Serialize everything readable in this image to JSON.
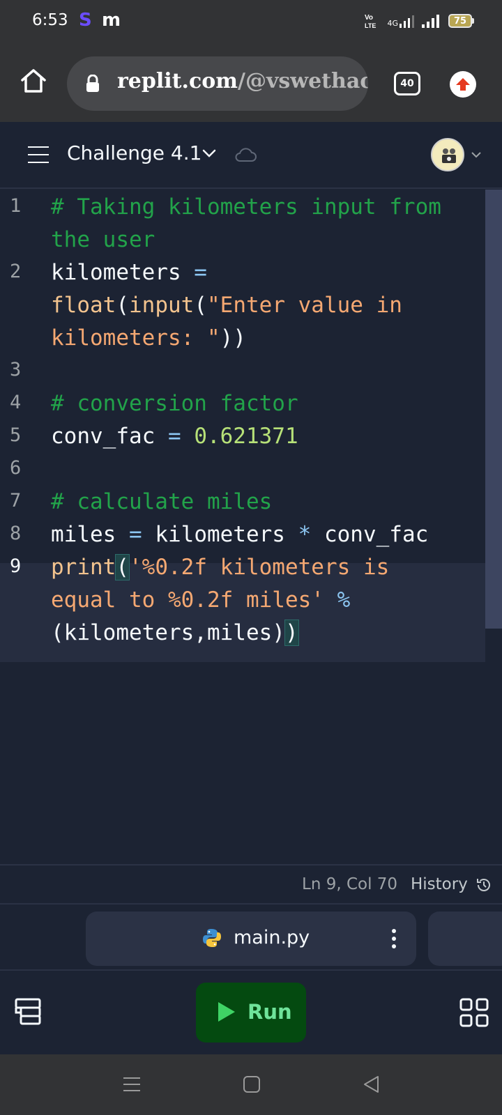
{
  "status_bar": {
    "time": "6:53",
    "notif_icons": [
      "S",
      "m"
    ],
    "network": "4G",
    "battery": "75"
  },
  "browser": {
    "url_domain": "replit.com",
    "url_path": "/@vswethacs",
    "tab_count": "40"
  },
  "header": {
    "project_title": "Challenge 4.1"
  },
  "editor": {
    "line_numbers": [
      "1",
      "2",
      "3",
      "4",
      "5",
      "6",
      "7",
      "8",
      "9"
    ],
    "active_line": "9"
  },
  "code_lines": {
    "l1a": "# Taking kilometers input from",
    "l1b": "the user",
    "l2_var": "kilometers",
    "l2_eq": " =",
    "l2_float": "float",
    "l2_p1": "(",
    "l2_input": "input",
    "l2_p2": "(",
    "l2_str1": "\"Enter value in",
    "l2_str2": "kilometers: \"",
    "l2_close": "))",
    "l4": "# conversion factor",
    "l5_var": "conv_fac",
    "l5_eq": " = ",
    "l5_num": "0.621371",
    "l7": "# calculate miles",
    "l8_var": "miles",
    "l8_eq": " = ",
    "l8_a": "kilometers",
    "l8_op": " * ",
    "l8_b": "conv_fac",
    "l9_print": "print",
    "l9_open": "(",
    "l9_str1": "'%0.2f kilometers is",
    "l9_str2": "equal to %0.2f miles'",
    "l9_mod": " %",
    "l9_args": "(kilometers,miles)",
    "l9_close": ")"
  },
  "statusline": {
    "cursor_pos": "Ln 9, Col 70",
    "history_label": "History"
  },
  "file_tab": {
    "filename": "main.py"
  },
  "toolbar": {
    "run_label": "Run"
  }
}
